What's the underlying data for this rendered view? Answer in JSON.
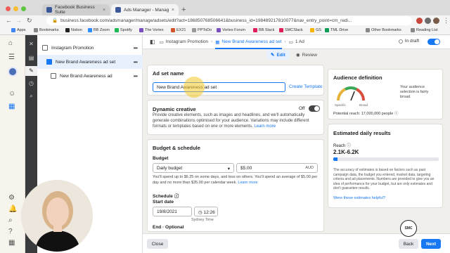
{
  "browser": {
    "tabs": [
      {
        "title": "Facebook Business Suite",
        "active": false
      },
      {
        "title": "Ads Manager - Manage ads -",
        "active": true
      }
    ],
    "url": "business.facebook.com/adsmanager/manage/adsets/edit?act=186850768506641&business_id=198489217810077&nav_entry_point=cm_redi...",
    "bookmarks": [
      "Apps",
      "Bookmarks",
      "Notion",
      "BB Zoom",
      "Spotify",
      "The Vortex",
      "EX21",
      "PPToDo",
      "Vortex Forum",
      "BB Slack",
      "SMCSlack",
      "GS",
      "TML Drive"
    ],
    "other_bookmarks": "Other Bookmarks",
    "reading_list": "Reading List"
  },
  "tree": {
    "campaign": "Instagram Promotion",
    "adset": "New Brand Awareness ad set",
    "ad": "New Brand Awareness ad"
  },
  "topbar": {
    "crumbs": [
      "Instagram Promotion",
      "New Brand Awareness ad set",
      "1 Ad"
    ],
    "status": "In draft"
  },
  "modes": {
    "edit": "Edit",
    "review": "Review"
  },
  "adset_name": {
    "title": "Ad set name",
    "value": "New Brand Awareness ad set",
    "template_link": "Create Template"
  },
  "dynamic_creative": {
    "title": "Dynamic creative",
    "toggle_label": "Off",
    "description": "Provide creative elements, such as images and headlines, and we'll automatically generate combinations optimised for your audience. Variations may include different formats or templates based on one or more elements.",
    "learn_more": "Learn more"
  },
  "budget": {
    "section_title": "Budget & schedule",
    "budget_label": "Budget",
    "budget_type": "Daily budget",
    "amount": "$5.00",
    "currency": "AUD",
    "note": "You'll spend up to $6.25 on some days, and less on others. You'll spend an average of $5.00 per day and no more than $35.00 per calendar week.",
    "learn_more": "Learn more",
    "schedule_label": "Schedule",
    "start_label": "Start date",
    "start_date": "19/8/2021",
    "start_time": "12:26",
    "timezone": "Sydney Time",
    "end_label": "End · Optional"
  },
  "audience": {
    "title": "Audience definition",
    "description": "Your audience selection is fairly broad.",
    "specific": "Specific",
    "broad": "Broad",
    "reach_text": "Potential reach: 17,000,000 people",
    "gauge_level": 0.62
  },
  "estimates": {
    "title": "Estimated daily results",
    "reach_label": "Reach",
    "reach_value": "2.1K-6.2K",
    "reach_fill": 0.04,
    "disclaimer": "The accuracy of estimates is based on factors such as past campaign data, the budget you entered, market data, targeting criteria and ad placements. Numbers are provided to give you an idea of performance for your budget, but are only estimates and don't guarantee results.",
    "link": "Were these estimates helpful?"
  },
  "footer": {
    "close": "Close",
    "back": "Back",
    "next": "Next"
  },
  "watermark": {
    "label": "SOCIAL MEDIA COLLEGE"
  },
  "colors": {
    "accent": "#1877f2",
    "rail": "#3a3b3c",
    "selected_bg": "#e7f0fd"
  }
}
